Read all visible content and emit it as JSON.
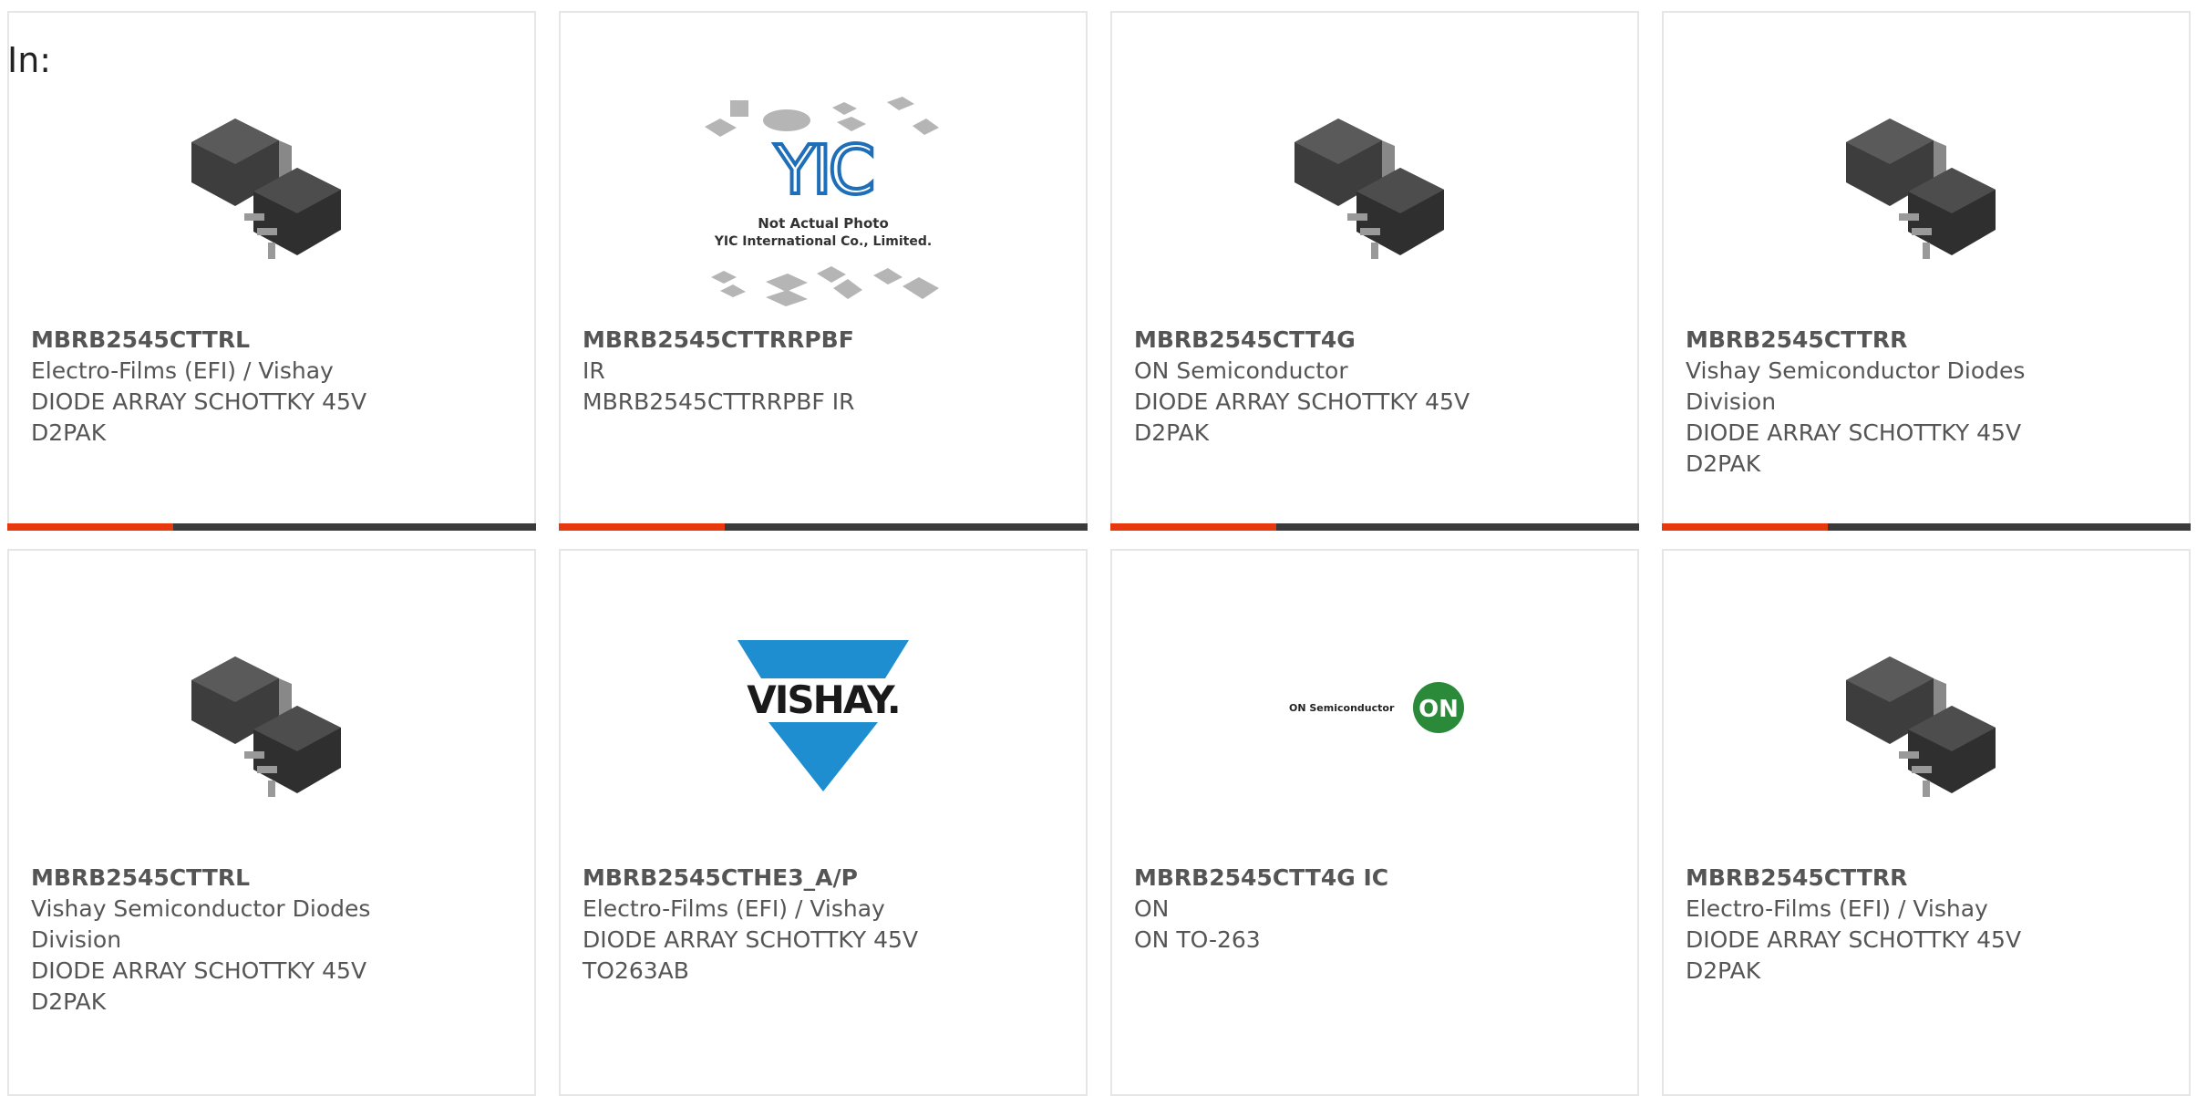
{
  "heading": "In:",
  "cards": [
    {
      "part": "MBRB2545CTTRL",
      "maker": "Electro-Films (EFI) / Vishay",
      "desc1": "DIODE ARRAY SCHOTTKY 45V",
      "desc2": "D2PAK",
      "image": "d2pak-package-icon"
    },
    {
      "part": "MBRB2545CTTRRPBF",
      "maker": "IR",
      "desc1": "MBRB2545CTTRRPBF IR",
      "desc2": "",
      "image": "yic-not-actual-photo-icon",
      "image_text": [
        "Not Actual Photo",
        "YIC International Co., Limited."
      ]
    },
    {
      "part": "MBRB2545CTT4G",
      "maker": "ON Semiconductor",
      "desc1": "DIODE ARRAY SCHOTTKY 45V",
      "desc2": "D2PAK",
      "image": "d2pak-package-icon"
    },
    {
      "part": "MBRB2545CTTRR",
      "maker": "Vishay Semiconductor Diodes Division",
      "desc1": "DIODE ARRAY SCHOTTKY 45V",
      "desc2": "D2PAK",
      "image": "d2pak-package-icon"
    },
    {
      "part": "MBRB2545CTTRL",
      "maker": "Vishay Semiconductor Diodes Division",
      "desc1": "DIODE ARRAY SCHOTTKY 45V",
      "desc2": "D2PAK",
      "image": "d2pak-package-icon"
    },
    {
      "part": "MBRB2545CTHE3_A/P",
      "maker": "Electro-Films (EFI) / Vishay",
      "desc1": "DIODE ARRAY SCHOTTKY 45V",
      "desc2": "TO263AB",
      "image": "vishay-logo",
      "image_text": [
        "VISHAY."
      ]
    },
    {
      "part": "MBRB2545CTT4G IC",
      "maker": "ON",
      "desc1": "ON TO-263",
      "desc2": "",
      "image": "on-semiconductor-logo",
      "image_text": [
        "ON Semiconductor",
        "ON"
      ]
    },
    {
      "part": "MBRB2545CTTRR",
      "maker": "Electro-Films (EFI) / Vishay",
      "desc1": "DIODE ARRAY SCHOTTKY 45V",
      "desc2": "D2PAK",
      "image": "d2pak-package-icon"
    }
  ],
  "colors": {
    "accent": "#e8380d",
    "bar_dark": "#3a3a3a",
    "text": "#555555",
    "border": "#e6e6e6",
    "yic_blue": "#1e6fb8",
    "vishay_blue": "#1f8ed0",
    "on_green": "#2a8a3a"
  }
}
